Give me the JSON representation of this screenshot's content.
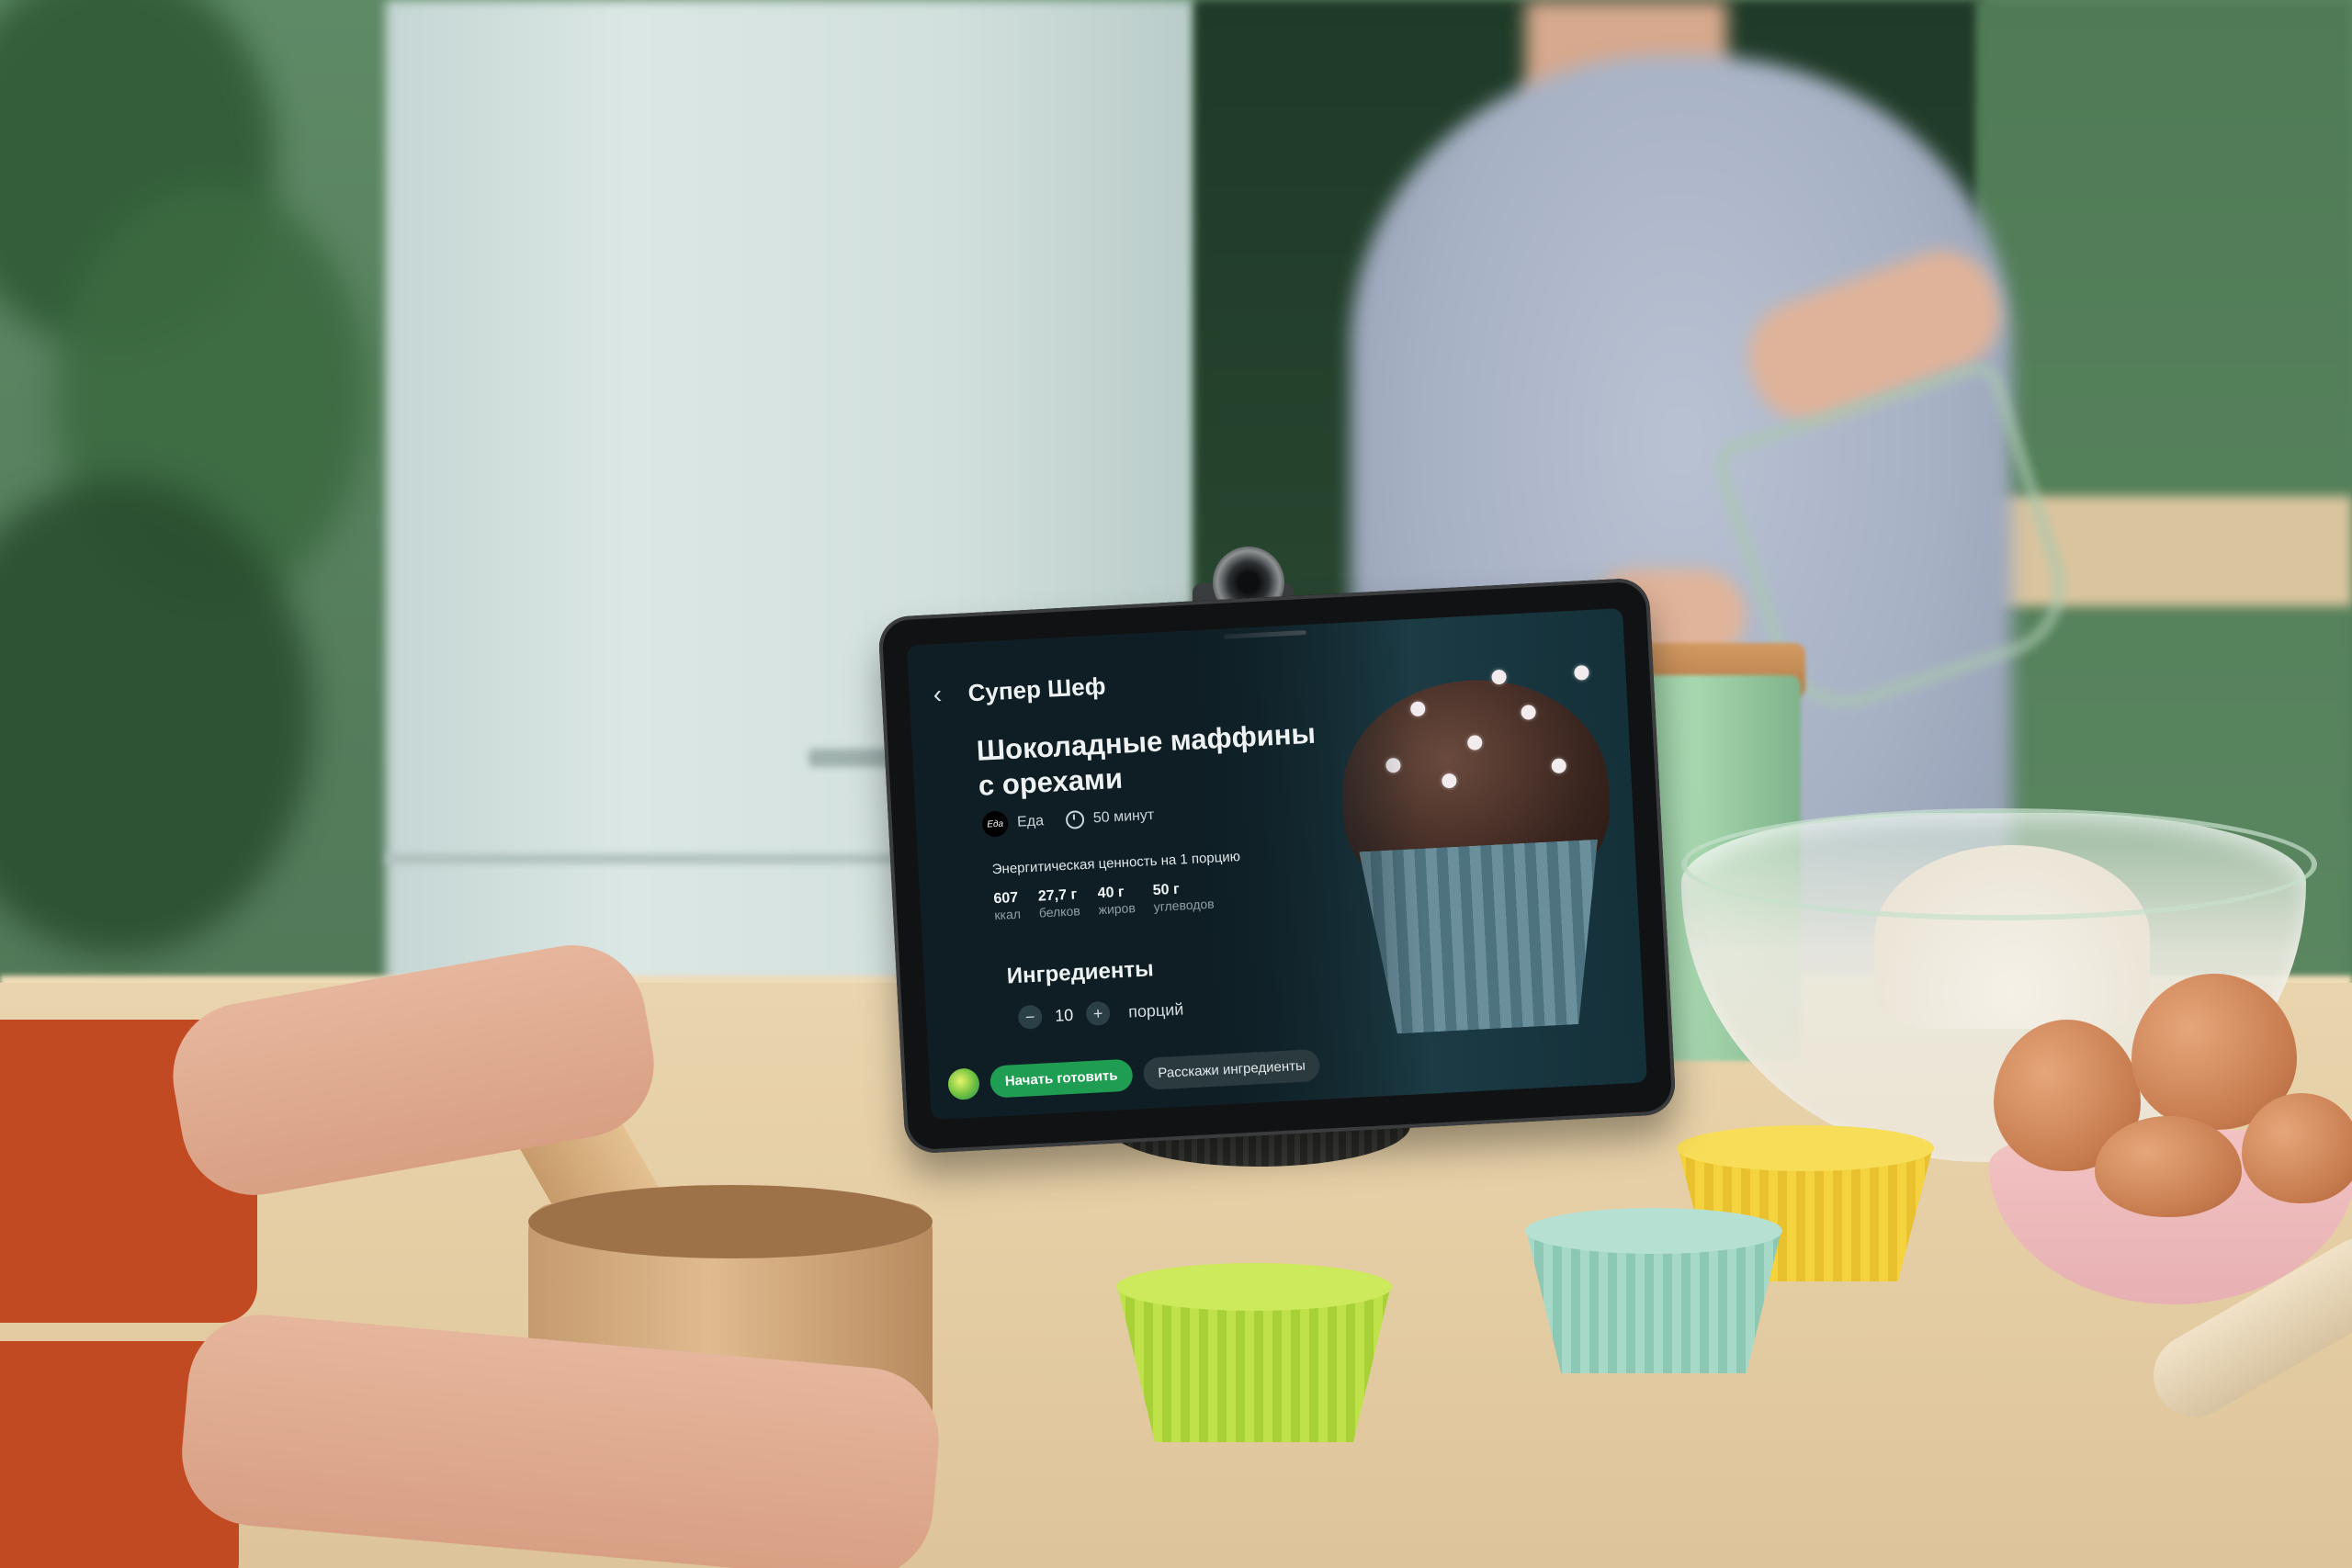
{
  "device_screen": {
    "app_title": "Супер Шеф",
    "recipe": {
      "title_line1": "Шоколадные маффины",
      "title_line2": "с орехами",
      "source": "Еда",
      "source_logo_text": "Еда",
      "duration": "50 минут"
    },
    "energy": {
      "label": "Энергитическая ценность на 1 порцию",
      "items": [
        {
          "value": "607",
          "unit": "ккал"
        },
        {
          "value": "27,7 г",
          "unit": "белков"
        },
        {
          "value": "40 г",
          "unit": "жиров"
        },
        {
          "value": "50 г",
          "unit": "углеводов"
        }
      ]
    },
    "ingredients": {
      "title": "Ингредиенты",
      "portions_value": "10",
      "portions_label": "порций",
      "minus": "−",
      "plus": "+"
    },
    "actions": {
      "start_cooking": "Начать готовить",
      "tell_ingredients": "Расскажи ингредиенты"
    },
    "icons": [
      "back-icon",
      "timer-icon",
      "assistant-orb-icon"
    ],
    "colors": {
      "primary_button": "#1f9d52",
      "secondary_button": "#2b3a3f",
      "screen_background": "#0e1e24"
    }
  }
}
